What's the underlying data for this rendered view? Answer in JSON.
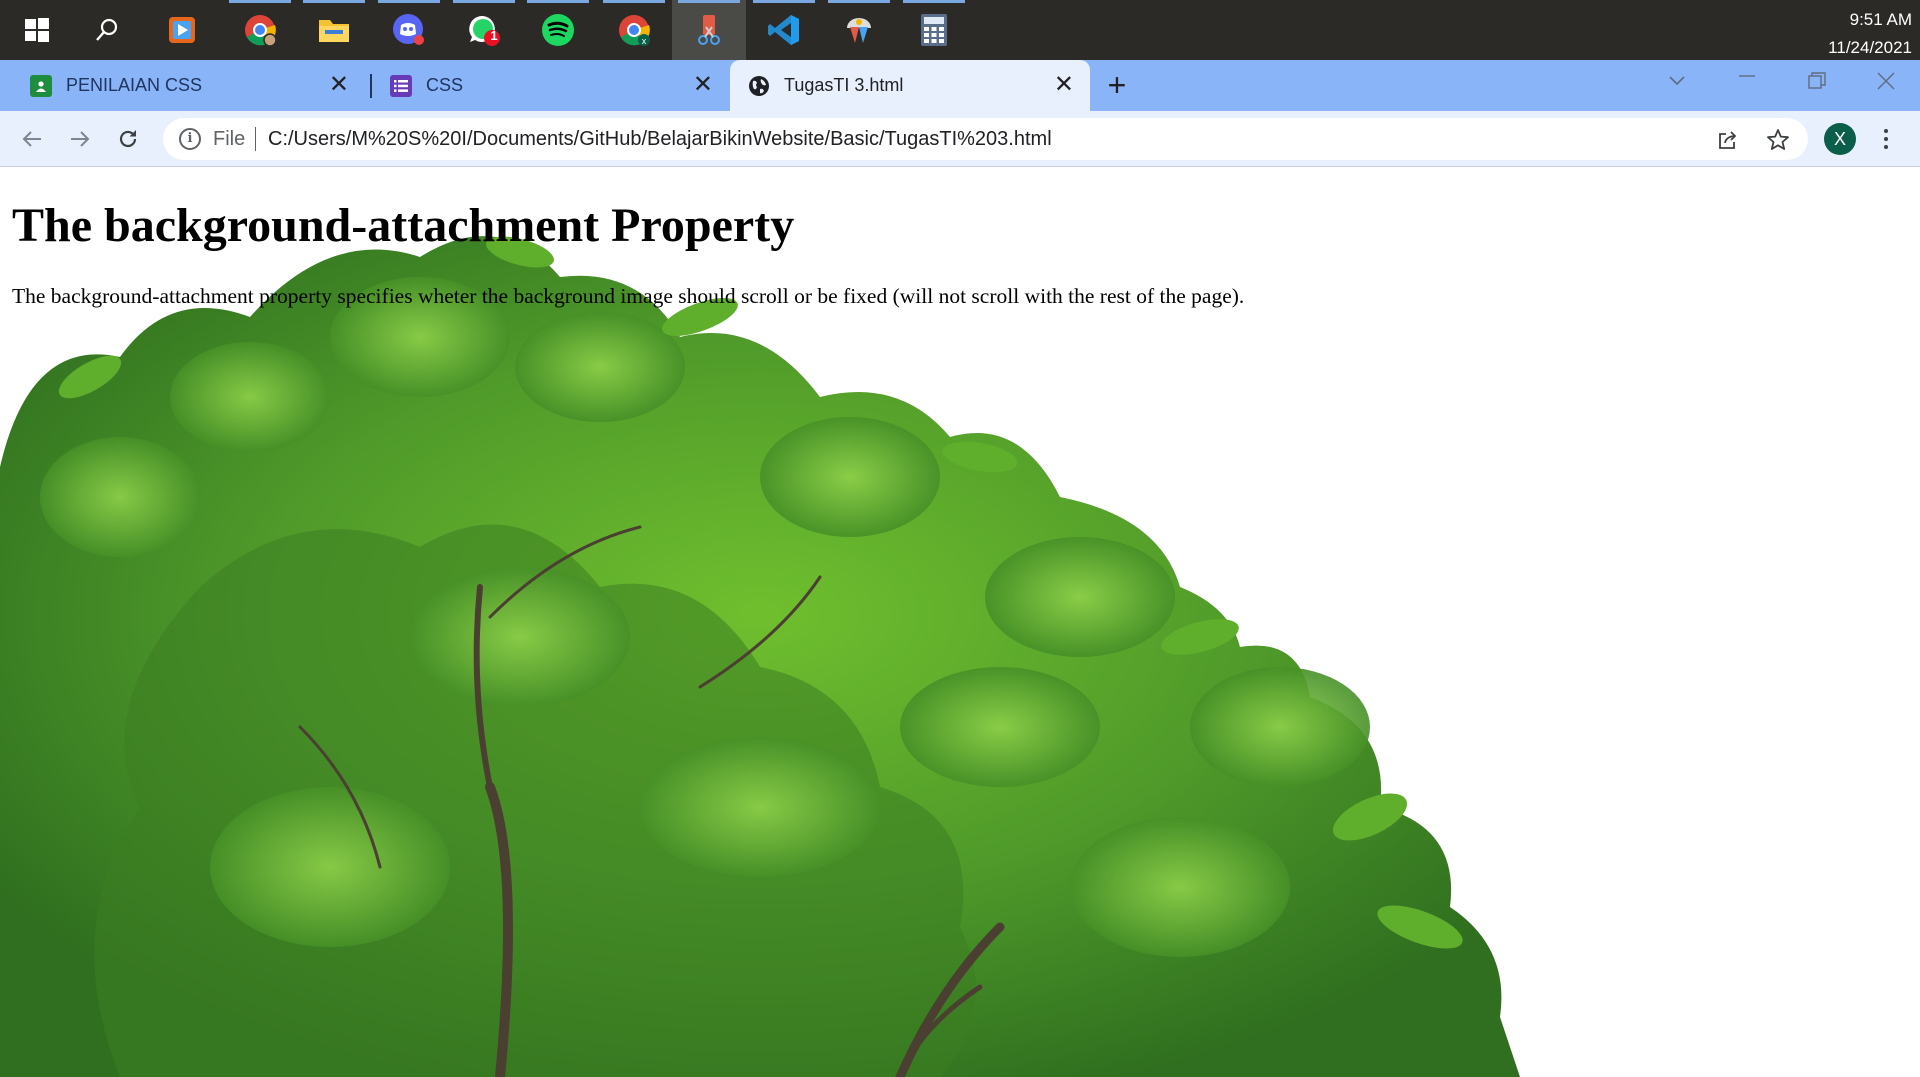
{
  "taskbar": {
    "apps": [
      {
        "name": "start-button",
        "icon": "windows-logo-icon"
      },
      {
        "name": "search-button",
        "icon": "search-icon"
      },
      {
        "name": "media-player",
        "icon": "media-player-icon"
      },
      {
        "name": "chrome-profile-1",
        "icon": "chrome-icon"
      },
      {
        "name": "file-explorer",
        "icon": "folder-icon"
      },
      {
        "name": "discord",
        "icon": "discord-icon"
      },
      {
        "name": "whatsapp",
        "icon": "whatsapp-icon",
        "badge": "1"
      },
      {
        "name": "spotify",
        "icon": "spotify-icon"
      },
      {
        "name": "chrome-profile-2",
        "icon": "chrome-icon"
      },
      {
        "name": "snipping-tool",
        "icon": "snipping-tool-icon"
      },
      {
        "name": "vscode",
        "icon": "vscode-icon"
      },
      {
        "name": "paint-tool",
        "icon": "paint-icon"
      },
      {
        "name": "calculator",
        "icon": "calculator-icon"
      }
    ],
    "time": "9:51 AM",
    "date": "11/24/2021"
  },
  "tabs": [
    {
      "title": "PENILAIAN CSS",
      "icon": "google-classroom-icon",
      "active": false
    },
    {
      "title": "CSS",
      "icon": "google-forms-icon",
      "active": false
    },
    {
      "title": "TugasTI 3.html",
      "icon": "globe-icon",
      "active": true
    }
  ],
  "omnibox": {
    "scheme_label": "File",
    "url": "C:/Users/M%20S%20I/Documents/GitHub/BelajarBikinWebsite/Basic/TugasTI%203.html"
  },
  "profile": {
    "initial": "X",
    "color": "#0b5e4a"
  },
  "page": {
    "heading": "The background-attachment Property",
    "paragraph": "The background-attachment property specifies wheter the background image should scroll or be fixed (will not scroll with the rest of the page)."
  },
  "colors": {
    "taskbar": "#2b2a27",
    "tabstrip": "#8ab4f8",
    "toolbar": "#e9f0fd",
    "foliage": "#4f9a2a"
  }
}
